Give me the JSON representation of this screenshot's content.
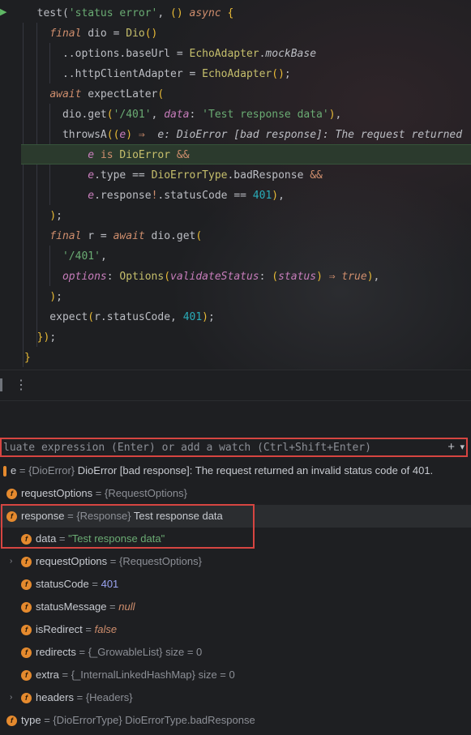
{
  "editor": {
    "lines": [
      [
        [
          "tk-pl",
          "  test("
        ],
        [
          "tk-str",
          "'status error'"
        ],
        [
          "tk-pl",
          ", "
        ],
        [
          "tk-br",
          "()"
        ],
        [
          "tk-pl",
          " "
        ],
        [
          "tk-kw",
          "async"
        ],
        [
          "tk-pl",
          " "
        ],
        [
          "tk-br",
          "{"
        ]
      ],
      [
        [
          "tk-pl",
          "    "
        ],
        [
          "tk-kw",
          "final"
        ],
        [
          "tk-pl",
          " dio = "
        ],
        [
          "tk-cls",
          "Dio"
        ],
        [
          "tk-br",
          "()"
        ]
      ],
      [
        [
          "tk-pl",
          "      ..options.baseUrl = "
        ],
        [
          "tk-cls",
          "EchoAdapter"
        ],
        [
          "tk-pl",
          "."
        ],
        [
          "tk-mock",
          "mockBase"
        ]
      ],
      [
        [
          "tk-pl",
          "      ..httpClientAdapter = "
        ],
        [
          "tk-cls",
          "EchoAdapter"
        ],
        [
          "tk-br",
          "()"
        ],
        [
          "tk-pl",
          ";"
        ]
      ],
      [
        [
          "tk-pl",
          "    "
        ],
        [
          "tk-kw",
          "await"
        ],
        [
          "tk-pl",
          " expectLater"
        ],
        [
          "tk-br",
          "("
        ]
      ],
      [
        [
          "tk-pl",
          "      dio.get"
        ],
        [
          "tk-br",
          "("
        ],
        [
          "tk-str",
          "'/401'"
        ],
        [
          "tk-pl",
          ", "
        ],
        [
          "tk-named",
          "data"
        ],
        [
          "tk-pl",
          ": "
        ],
        [
          "tk-str",
          "'Test response data'"
        ],
        [
          "tk-br",
          ")"
        ],
        [
          "tk-pl",
          ","
        ]
      ],
      [
        [
          "tk-pl",
          "      throwsA"
        ],
        [
          "tk-br",
          "("
        ],
        [
          "tk-br",
          "("
        ],
        [
          "tk-prm",
          "e"
        ],
        [
          "tk-br",
          ")"
        ],
        [
          "tk-pl",
          " "
        ],
        [
          "tk-kw2",
          "⇒"
        ],
        [
          "tk-pl",
          "  "
        ],
        [
          "tk-hint",
          "e: DioError [bad response]: The request returned"
        ]
      ],
      [
        [
          "tk-pl",
          "          "
        ],
        [
          "tk-prm",
          "e"
        ],
        [
          "tk-pl",
          " "
        ],
        [
          "tk-kw2",
          "is"
        ],
        [
          "tk-pl",
          " "
        ],
        [
          "tk-cls",
          "DioError"
        ],
        [
          "tk-pl",
          " "
        ],
        [
          "tk-kw2",
          "&&"
        ]
      ],
      [
        [
          "tk-pl",
          "          "
        ],
        [
          "tk-prm",
          "e"
        ],
        [
          "tk-pl",
          ".type "
        ],
        [
          "tk-pl",
          "=="
        ],
        [
          "tk-pl",
          " "
        ],
        [
          "tk-cls",
          "DioErrorType"
        ],
        [
          "tk-pl",
          ".badResponse "
        ],
        [
          "tk-kw2",
          "&&"
        ]
      ],
      [
        [
          "tk-pl",
          "          "
        ],
        [
          "tk-prm",
          "e"
        ],
        [
          "tk-pl",
          ".response"
        ],
        [
          "tk-kw2",
          "!"
        ],
        [
          "tk-pl",
          ".statusCode "
        ],
        [
          "tk-pl",
          "=="
        ],
        [
          "tk-pl",
          " "
        ],
        [
          "tk-num",
          "401"
        ],
        [
          "tk-br",
          ")"
        ],
        [
          "tk-pl",
          ","
        ]
      ],
      [
        [
          "tk-pl",
          "    "
        ],
        [
          "tk-br",
          ")"
        ],
        [
          "tk-pl",
          ";"
        ]
      ],
      [
        [
          "tk-pl",
          "    "
        ],
        [
          "tk-kw",
          "final"
        ],
        [
          "tk-pl",
          " r = "
        ],
        [
          "tk-kw",
          "await"
        ],
        [
          "tk-pl",
          " dio.get"
        ],
        [
          "tk-br",
          "("
        ]
      ],
      [
        [
          "tk-pl",
          "      "
        ],
        [
          "tk-str",
          "'/401'"
        ],
        [
          "tk-pl",
          ","
        ]
      ],
      [
        [
          "tk-pl",
          "      "
        ],
        [
          "tk-named",
          "options"
        ],
        [
          "tk-pl",
          ": "
        ],
        [
          "tk-cls",
          "Options"
        ],
        [
          "tk-br",
          "("
        ],
        [
          "tk-named",
          "validateStatus"
        ],
        [
          "tk-pl",
          ": "
        ],
        [
          "tk-br",
          "("
        ],
        [
          "tk-prm",
          "status"
        ],
        [
          "tk-br",
          ")"
        ],
        [
          "tk-pl",
          " "
        ],
        [
          "tk-kw2",
          "⇒"
        ],
        [
          "tk-pl",
          " "
        ],
        [
          "tk-kw",
          "true"
        ],
        [
          "tk-br",
          ")"
        ],
        [
          "tk-pl",
          ","
        ]
      ],
      [
        [
          "tk-pl",
          "    "
        ],
        [
          "tk-br",
          ")"
        ],
        [
          "tk-pl",
          ";"
        ]
      ],
      [
        [
          "tk-pl",
          "    expect"
        ],
        [
          "tk-br",
          "("
        ],
        [
          "tk-pl",
          "r.statusCode, "
        ],
        [
          "tk-num",
          "401"
        ],
        [
          "tk-br",
          ")"
        ],
        [
          "tk-pl",
          ";"
        ]
      ],
      [
        [
          "tk-pl",
          "  "
        ],
        [
          "tk-br",
          "}"
        ],
        [
          "tk-br",
          ")"
        ],
        [
          "tk-pl",
          ";"
        ]
      ],
      [
        [
          "tk-br",
          "}"
        ]
      ]
    ]
  },
  "toolbar": {
    "more": "⋮"
  },
  "watch": {
    "placeholder": "luate expression (Enter) or add a watch (Ctrl+Shift+Enter)",
    "add_icon": "+",
    "dropdown_icon": "▾"
  },
  "variables": [
    {
      "indent": 0,
      "expand": "",
      "name": "e",
      "type": "{DioError}",
      "value": "DioError [bad response]: The request returned an invalid status code of 401.",
      "vclass": "vval",
      "icon": "variable-icon"
    },
    {
      "indent": 1,
      "expand": "",
      "name": "requestOptions",
      "type": "{RequestOptions}",
      "value": "",
      "vclass": "vval",
      "icon": "field-icon"
    },
    {
      "indent": 1,
      "expand": "",
      "name": "response",
      "type": "{Response}",
      "value": "Test response data",
      "vclass": "vval",
      "icon": "field-icon",
      "selected": true
    },
    {
      "indent": 2,
      "expand": "",
      "name": "data",
      "type": "",
      "value": "\"Test response data\"",
      "vclass": "vstr",
      "icon": "field-icon"
    },
    {
      "indent": 2,
      "expand": "›",
      "name": "requestOptions",
      "type": "{RequestOptions}",
      "value": "",
      "vclass": "vval",
      "icon": "field-icon"
    },
    {
      "indent": 2,
      "expand": "",
      "name": "statusCode",
      "type": "",
      "value": "401",
      "vclass": "vnum",
      "icon": "field-icon"
    },
    {
      "indent": 2,
      "expand": "",
      "name": "statusMessage",
      "type": "",
      "value": "null",
      "vclass": "vkw",
      "icon": "field-icon"
    },
    {
      "indent": 2,
      "expand": "",
      "name": "isRedirect",
      "type": "",
      "value": "false",
      "vclass": "vkw",
      "icon": "field-icon"
    },
    {
      "indent": 2,
      "expand": "",
      "name": "redirects",
      "type": "{_GrowableList}",
      "value": "size = 0",
      "vclass": "vtype",
      "icon": "field-icon"
    },
    {
      "indent": 2,
      "expand": "",
      "name": "extra",
      "type": "{_InternalLinkedHashMap}",
      "value": "size = 0",
      "vclass": "vtype",
      "icon": "field-icon"
    },
    {
      "indent": 2,
      "expand": "›",
      "name": "headers",
      "type": "{Headers}",
      "value": "",
      "vclass": "vval",
      "icon": "field-icon"
    },
    {
      "indent": 1,
      "expand": "",
      "name": "type",
      "type": "{DioErrorType}",
      "value": "DioErrorType.badResponse",
      "vclass": "vtype",
      "icon": "field-icon"
    }
  ]
}
